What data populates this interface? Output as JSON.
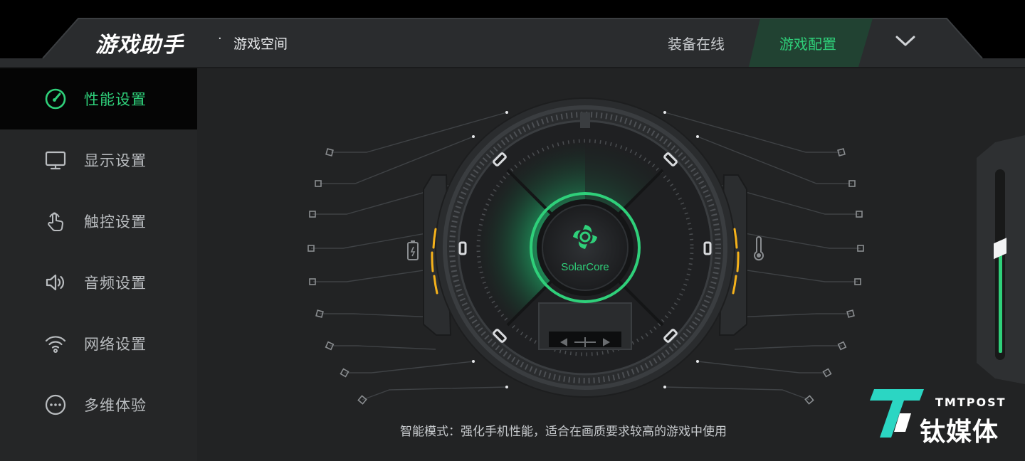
{
  "header": {
    "brand": "游戏助手",
    "separator": "·",
    "subtitle": "游戏空间",
    "tabs": [
      {
        "label": "装备在线",
        "active": false
      },
      {
        "label": "游戏配置",
        "active": true
      }
    ],
    "expand_icon": "chevron-down-icon"
  },
  "sidebar": {
    "items": [
      {
        "label": "性能设置",
        "icon": "speedometer-icon",
        "active": true
      },
      {
        "label": "显示设置",
        "icon": "monitor-icon",
        "active": false
      },
      {
        "label": "触控设置",
        "icon": "touch-hand-icon",
        "active": false
      },
      {
        "label": "音频设置",
        "icon": "speaker-icon",
        "active": false
      },
      {
        "label": "网络设置",
        "icon": "wifi-icon",
        "active": false
      },
      {
        "label": "多维体验",
        "icon": "more-icon",
        "active": false
      }
    ]
  },
  "dial": {
    "core_name": "SolarCore",
    "left_gauge_icon": "battery-icon",
    "right_gauge_icon": "thermometer-icon"
  },
  "mode_description": "智能模式：强化手机性能，适合在画质要求较高的游戏中使用",
  "slider": {
    "level": 0.62
  },
  "watermark": {
    "en": "TMTPOST",
    "cn": "钛媒体"
  },
  "colors": {
    "accent": "#2fd07a",
    "gauge": "#f5b21b",
    "panel": "#252627"
  }
}
